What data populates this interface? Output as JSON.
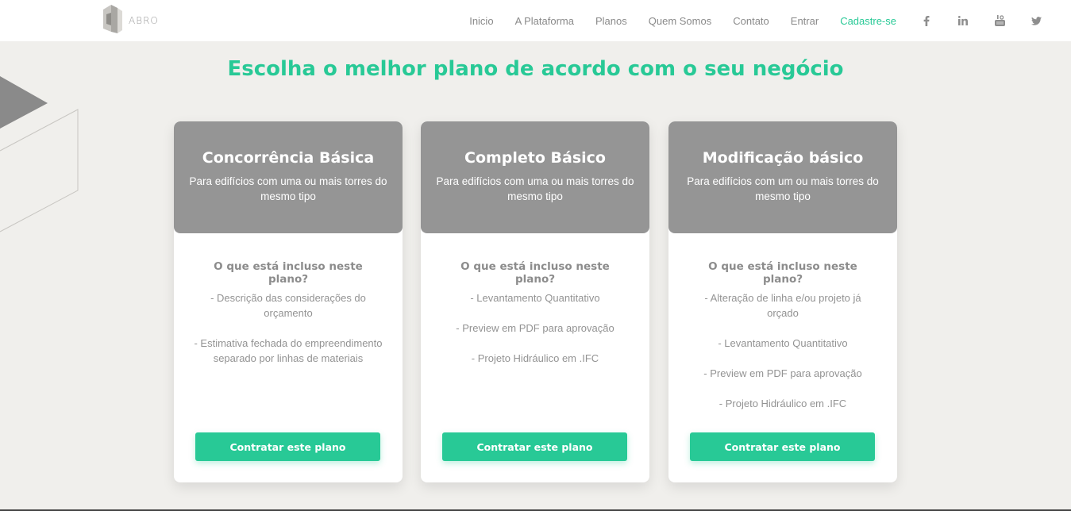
{
  "header": {
    "logo_text": "ABRO",
    "nav": [
      {
        "label": "Inicio"
      },
      {
        "label": "A Plataforma"
      },
      {
        "label": "Planos"
      },
      {
        "label": "Quem Somos"
      },
      {
        "label": "Contato"
      },
      {
        "label": "Entrar"
      },
      {
        "label": "Cadastre-se"
      }
    ],
    "social_icons": [
      "facebook-icon",
      "linkedin-icon",
      "youtube-icon",
      "twitter-icon"
    ]
  },
  "main": {
    "heading": "Escolha o melhor plano de acordo com o seu negócio",
    "includes_title": "O que está incluso neste plano?",
    "button_label": "Contratar este plano",
    "plans": [
      {
        "title": "Concorrência Básica",
        "subtitle": "Para edifícios com uma ou mais torres do mesmo tipo",
        "includes_title": "O que está incluso neste plano?",
        "features": [
          "- Descrição das considerações do orçamento",
          "- Estimativa fechada do empreendimento separado por linhas de materiais"
        ],
        "button": "Contratar este plano"
      },
      {
        "title": "Completo Básico",
        "subtitle": "Para edifícios com uma ou mais torres do mesmo tipo",
        "includes_title": "O que está incluso neste plano?",
        "features": [
          "- Levantamento Quantitativo",
          "- Preview em PDF para aprovação",
          "- Projeto Hidráulico em .IFC"
        ],
        "button": "Contratar este plano"
      },
      {
        "title": "Modificação básico",
        "subtitle": "Para edifícios com um ou mais torres do mesmo tipo",
        "includes_title": "O que está incluso neste plano?",
        "features": [
          "- Alteração de linha e/ou projeto já orçado",
          "- Levantamento Quantitativo",
          "- Preview em PDF para aprovação",
          "- Projeto Hidráulico em .IFC"
        ],
        "button": "Contratar este plano"
      }
    ]
  },
  "colors": {
    "accent": "#28c996",
    "card_header": "#959595",
    "page_bg": "#f0efec"
  }
}
